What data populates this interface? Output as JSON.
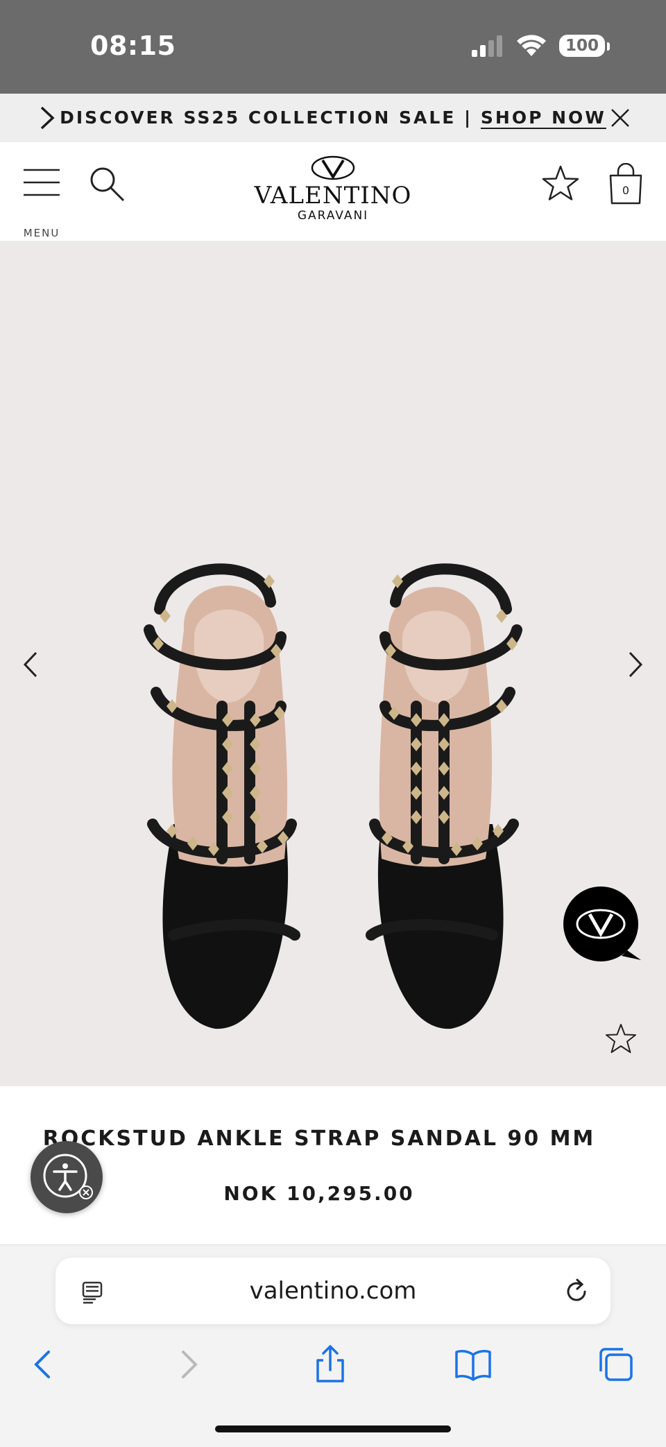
{
  "status_bar": {
    "time": "08:15",
    "battery": "100"
  },
  "promo": {
    "text": "DISCOVER SS25 COLLECTION SALE | ",
    "link": "SHOP NOW"
  },
  "header": {
    "menu_label": "MENU",
    "logo_name": "VALENTINO",
    "logo_sub": "GARAVANI",
    "bag_count": "0"
  },
  "product": {
    "name": "ROCKSTUD ANKLE STRAP SANDAL 90 MM",
    "price": "NOK 10,295.00"
  },
  "browser": {
    "url": "valentino.com"
  },
  "icons": {
    "promo_arrow": "chevron-right-icon",
    "promo_close": "close-icon",
    "menu": "hamburger-icon",
    "search": "search-icon",
    "wishlist": "star-icon",
    "bag": "shopping-bag-icon",
    "chat": "chat-bubble-icon",
    "accessibility": "accessibility-icon"
  },
  "colors": {
    "status_bar": "#6b6b6b",
    "promo_bg": "#eeeeee",
    "gallery_bg": "#ede9e8",
    "browser_accent": "#1a73e8"
  }
}
